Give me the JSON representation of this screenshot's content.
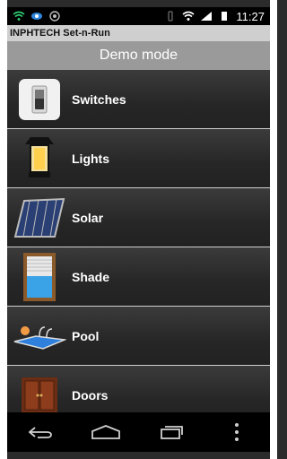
{
  "status_bar": {
    "time": "11:27"
  },
  "app": {
    "name": "INPHTECH Set-n-Run",
    "mode": "Demo mode"
  },
  "items": [
    {
      "label": "Switches",
      "icon": "switch-icon"
    },
    {
      "label": "Lights",
      "icon": "lantern-icon"
    },
    {
      "label": "Solar",
      "icon": "solar-panel-icon"
    },
    {
      "label": "Shade",
      "icon": "window-shade-icon"
    },
    {
      "label": "Pool",
      "icon": "pool-icon"
    },
    {
      "label": "Doors",
      "icon": "door-icon"
    }
  ],
  "navbar": {
    "back": "back-icon",
    "home": "home-icon",
    "recent": "recent-apps-icon",
    "menu": "overflow-menu-icon"
  }
}
